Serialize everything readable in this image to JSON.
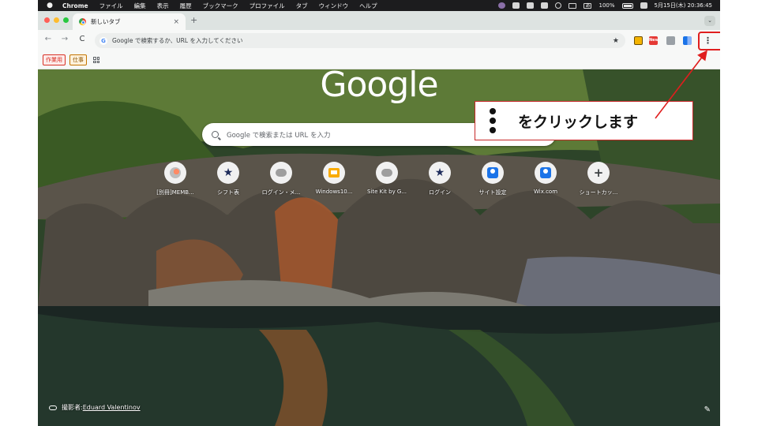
{
  "menubar": {
    "apple": "",
    "app_name": "Chrome",
    "items": [
      "ファイル",
      "編集",
      "表示",
      "履歴",
      "ブックマーク",
      "プロファイル",
      "タブ",
      "ウィンドウ",
      "ヘルプ"
    ],
    "ime_label": "あ",
    "battery": "100%",
    "datetime": "5月15日(木) 20:36:45"
  },
  "tab": {
    "title": "新しいタブ",
    "close": "×",
    "new_tab": "+",
    "tab_search": "⌄"
  },
  "toolbar": {
    "back": "←",
    "forward": "→",
    "reload": "C",
    "omnibox_placeholder": "Google で検索するか、URL を入力してください",
    "google_mini": "G",
    "bookmark_star": "★",
    "ext_new_label": "New",
    "menu": "⋮"
  },
  "bookmarks": [
    {
      "label": "作業用",
      "style": "red"
    },
    {
      "label": "仕事",
      "style": "orange"
    }
  ],
  "ntp": {
    "logo": "Google",
    "search_placeholder": "Google で検索または URL を入力",
    "shortcuts": [
      {
        "label": "[別冊]MEMB...",
        "icon": "tool-icon"
      },
      {
        "label": "シフト表",
        "icon": "star-icon"
      },
      {
        "label": "ログイン・メ...",
        "icon": "cloud-icon"
      },
      {
        "label": "Windows10...",
        "icon": "slides-icon"
      },
      {
        "label": "Site Kit by G...",
        "icon": "cloud-icon"
      },
      {
        "label": "ログイン",
        "icon": "star-icon"
      },
      {
        "label": "サイト設定",
        "icon": "user-icon"
      },
      {
        "label": "Wix.com",
        "icon": "user-icon"
      },
      {
        "label": "ショートカッ...",
        "icon": "plus-icon"
      }
    ],
    "credit_prefix": "撮影者:",
    "credit_name": "Eduard Valentinov",
    "edit": "✎"
  },
  "annotation": {
    "text": "をクリックします",
    "border_color": "#e01e1e"
  },
  "colors": {
    "tabstrip": "#dde3e1",
    "toolbar": "#f7f8f7",
    "accent_red": "#e01e1e"
  }
}
